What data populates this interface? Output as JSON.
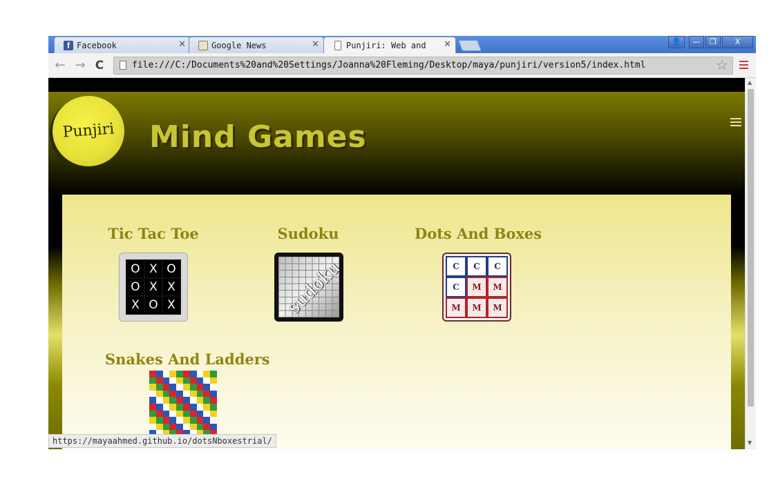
{
  "browser": {
    "tabs": [
      {
        "label": "Facebook",
        "favicon": "facebook-icon",
        "active": false
      },
      {
        "label": "Google News",
        "favicon": "news-icon",
        "active": false
      },
      {
        "label": "Punjiri: Web and",
        "favicon": "page-icon",
        "active": true
      }
    ],
    "close_glyph": "✕",
    "window_controls": {
      "user": "👤",
      "minimize": "—",
      "restore": "❐",
      "close": "X"
    },
    "back_glyph": "←",
    "forward_glyph": "→",
    "reload_glyph": "C",
    "url": "file:///C:/Documents%20and%20Settings/Joanna%20Fleming/Desktop/maya/punjiri/version5/index.html",
    "star_glyph": "☆",
    "status_url": "https://mayaahmed.github.io/dotsNboxestrial/"
  },
  "site": {
    "logo_text": "Punjiri",
    "title": "Mind Games"
  },
  "games": [
    {
      "title": "Tic Tac Toe",
      "cells": [
        "O",
        "X",
        "O",
        "O",
        "X",
        "X",
        "X",
        "O",
        "X"
      ]
    },
    {
      "title": "Sudoku",
      "image_text": "sudoku"
    },
    {
      "title": "Dots And Boxes",
      "cells": [
        "C",
        "C",
        "C",
        "C",
        "M",
        "M",
        "M",
        "M",
        "M"
      ]
    },
    {
      "title": "Snakes And Ladders"
    }
  ],
  "colors": {
    "header_olive": "#7c7a00",
    "title_gold": "#c9c436",
    "game_title": "#8d8614",
    "content_bg": "#eee68c",
    "chrome_blue": "#4a7fd0"
  }
}
